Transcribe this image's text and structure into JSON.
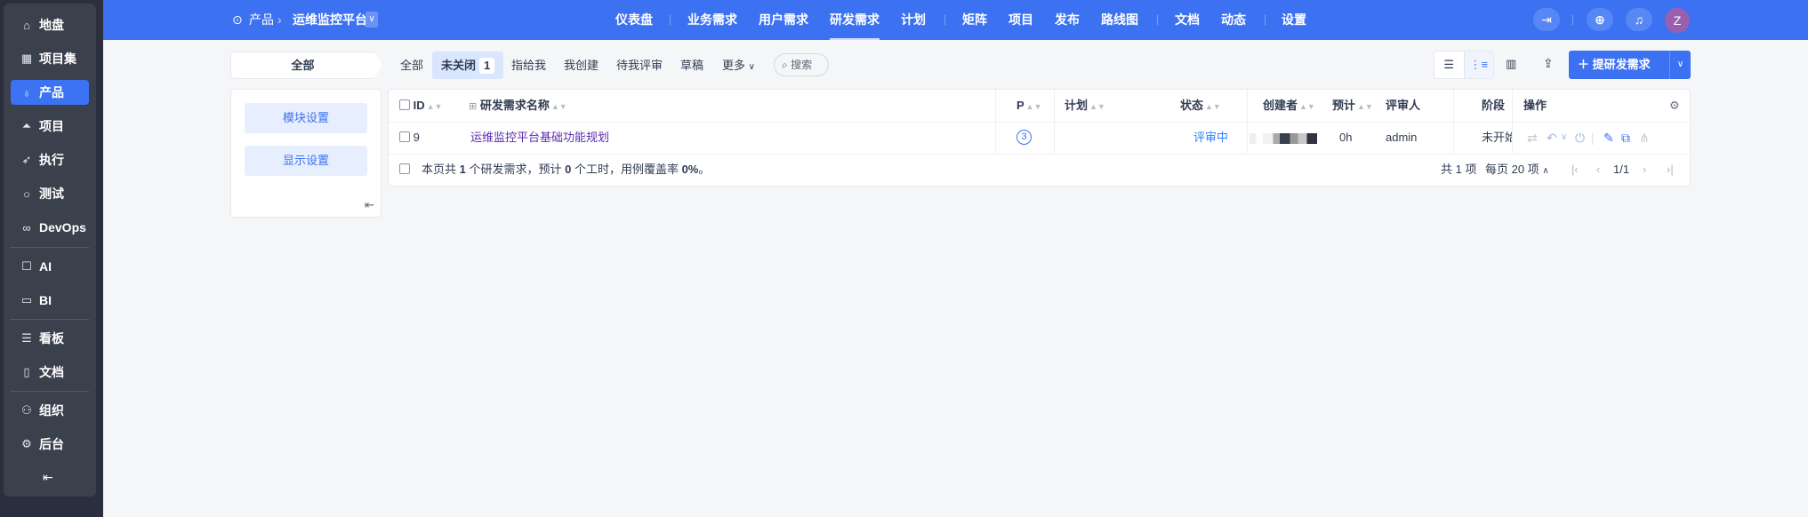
{
  "sidebar": {
    "items": [
      {
        "label": "地盘",
        "icon": "home-icon"
      },
      {
        "label": "项目集",
        "icon": "grid-icon"
      },
      {
        "label": "产品",
        "icon": "lightbulb-icon",
        "active": true
      },
      {
        "label": "项目",
        "icon": "rocket-icon"
      },
      {
        "label": "执行",
        "icon": "run-icon"
      },
      {
        "label": "测试",
        "icon": "test-search-icon"
      },
      {
        "label": "DevOps",
        "icon": "infinity-icon"
      },
      {
        "label": "AI",
        "icon": "robot-icon"
      },
      {
        "label": "BI",
        "icon": "board-chart-icon"
      },
      {
        "label": "看板",
        "icon": "kanban-icon"
      },
      {
        "label": "文档",
        "icon": "document-icon"
      },
      {
        "label": "组织",
        "icon": "users-icon"
      },
      {
        "label": "后台",
        "icon": "gear-icon"
      }
    ]
  },
  "breadcrumb": {
    "root": "产品",
    "current": "运维监控平台"
  },
  "nav": [
    "仪表盘",
    "业务需求",
    "用户需求",
    "研发需求",
    "计划",
    "矩阵",
    "项目",
    "发布",
    "路线图",
    "文档",
    "动态",
    "设置"
  ],
  "nav_active": "研发需求",
  "user": {
    "avatar_letter": "Z"
  },
  "module_label": "全部",
  "tabs": {
    "all": "全部",
    "open": "未关闭",
    "open_count": "1",
    "assigned": "指给我",
    "created": "我创建",
    "review": "待我评审",
    "draft": "草稿",
    "more": "更多",
    "search": "搜索"
  },
  "actions": {
    "create": "提研发需求"
  },
  "left_panel": {
    "module_settings": "模块设置",
    "display_settings": "显示设置"
  },
  "table": {
    "headers": {
      "id": "ID",
      "name": "研发需求名称",
      "pri": "P",
      "plan": "计划",
      "status": "状态",
      "creator": "创建者",
      "estimate": "预计",
      "reviewer": "评审人",
      "stage": "阶段",
      "actions": "操作"
    },
    "rows": [
      {
        "id": "9",
        "name": "运维监控平台基础功能规划",
        "pri": "3",
        "plan": "",
        "status": "评审中",
        "estimate": "0h",
        "reviewer": "admin",
        "stage": "未开始"
      }
    ],
    "summary_pre": "本页共 ",
    "summary_count": "1",
    "summary_mid": " 个研发需求，预计 ",
    "summary_hours": "0",
    "summary_mid2": " 个工时，用例覆盖率 ",
    "summary_rate": "0%",
    "summary_end": "。"
  },
  "pager": {
    "total": "共 1 项",
    "per_page": "每页 20 项",
    "page": "1/1"
  },
  "colors": {
    "brand": "#3c72f2",
    "link": "#5b2db0",
    "status": "#2e7fff"
  }
}
